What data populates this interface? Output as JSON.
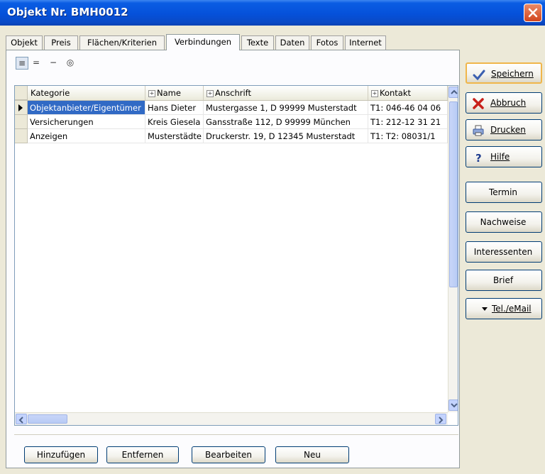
{
  "window": {
    "title": "Objekt Nr. BMH0012"
  },
  "tabs": [
    "Objekt",
    "Preis",
    "Flächen/Kriterien",
    "Verbindungen",
    "Texte",
    "Daten",
    "Fotos",
    "Internet"
  ],
  "toolbar": {
    "btn1": "≡",
    "btn2": "=",
    "btn3": "−",
    "btn4": "◎"
  },
  "grid": {
    "columns": [
      "Kategorie",
      "Name",
      "Anschrift",
      "Kontakt"
    ],
    "rows": [
      [
        "Objektanbieter/Eigentümer",
        "Hans Dieter",
        "Mustergasse 1, D   99999 Musterstadt",
        "T1: 046-46 04 06"
      ],
      [
        "Versicherungen",
        "Kreis Giesela",
        "Gansstraße 112, D   99999 München",
        "T1: 212-12 31 21"
      ],
      [
        "Anzeigen",
        "Musterstädte",
        "Druckerstr. 19, D   12345 Musterstadt",
        "T1:   T2: 08031/1"
      ]
    ]
  },
  "bottom_buttons": {
    "add": "Hinzufügen",
    "remove": "Entfernen",
    "edit": "Bearbeiten",
    "new": "Neu"
  },
  "side_buttons": {
    "save": "Speichern",
    "cancel": "Abbruch",
    "print": "Drucken",
    "help": "Hilfe",
    "termin": "Termin",
    "nachweise": "Nachweise",
    "interessenten": "Interessenten",
    "brief": "Brief",
    "tel": "Tel./eMail"
  },
  "colors": {
    "titlebar": "#0551da",
    "selection": "#316ac5",
    "focus_border": "#f0b64a"
  }
}
